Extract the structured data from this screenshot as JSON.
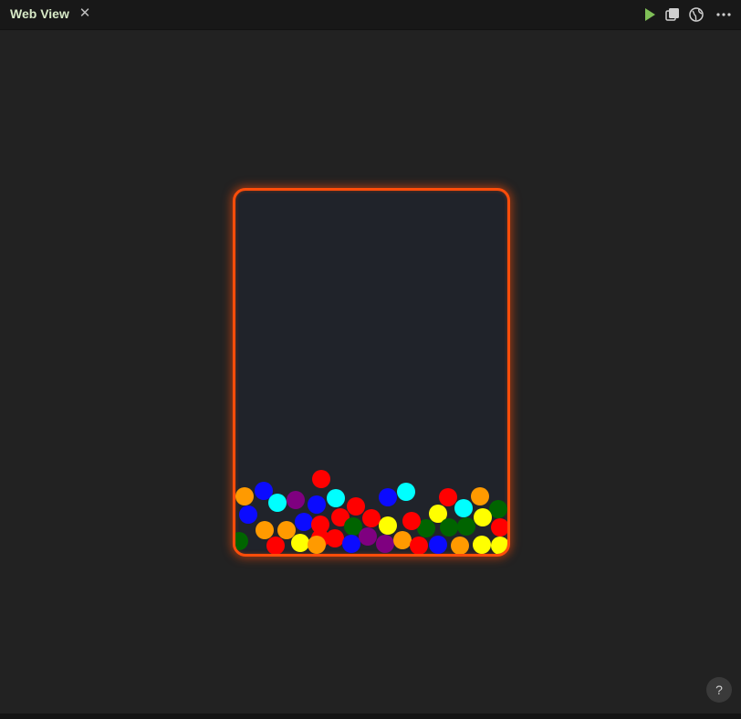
{
  "window": {
    "title": "Web View",
    "close_label": "✕"
  },
  "toolbar": {
    "run_icon": "play-icon",
    "duplicate_icon": "layers-icon",
    "browser_icon": "globe-icon",
    "more_icon": "more-dots-icon"
  },
  "colors": {
    "frame_border": "#ff4d0a",
    "frame_fill": "#20232a",
    "page_bg": "#222222"
  },
  "balls": [
    {
      "color": "orange"
    },
    {
      "color": "blue"
    },
    {
      "color": "purple"
    },
    {
      "color": "red"
    },
    {
      "color": "cyan"
    },
    {
      "color": "blue"
    },
    {
      "color": "cyan"
    },
    {
      "color": "blue"
    },
    {
      "color": "red"
    },
    {
      "color": "cyan"
    },
    {
      "color": "red"
    },
    {
      "color": "blue"
    },
    {
      "color": "cyan"
    },
    {
      "color": "orange"
    },
    {
      "color": "red"
    },
    {
      "color": "green"
    },
    {
      "color": "red"
    },
    {
      "color": "orange"
    },
    {
      "color": "blue"
    },
    {
      "color": "red"
    },
    {
      "color": "green"
    },
    {
      "color": "red"
    },
    {
      "color": "yellow"
    },
    {
      "color": "red"
    },
    {
      "color": "yellow"
    },
    {
      "color": "green"
    },
    {
      "color": "green"
    },
    {
      "color": "yellow"
    },
    {
      "color": "green"
    },
    {
      "color": "red"
    },
    {
      "color": "green"
    },
    {
      "color": "orange"
    },
    {
      "color": "red"
    },
    {
      "color": "yellow"
    },
    {
      "color": "orange"
    },
    {
      "color": "red"
    },
    {
      "color": "blue"
    },
    {
      "color": "purple"
    },
    {
      "color": "purple"
    },
    {
      "color": "orange"
    },
    {
      "color": "red"
    },
    {
      "color": "blue"
    },
    {
      "color": "orange"
    },
    {
      "color": "yellow"
    },
    {
      "color": "yellow"
    }
  ],
  "help": {
    "label": "?"
  }
}
